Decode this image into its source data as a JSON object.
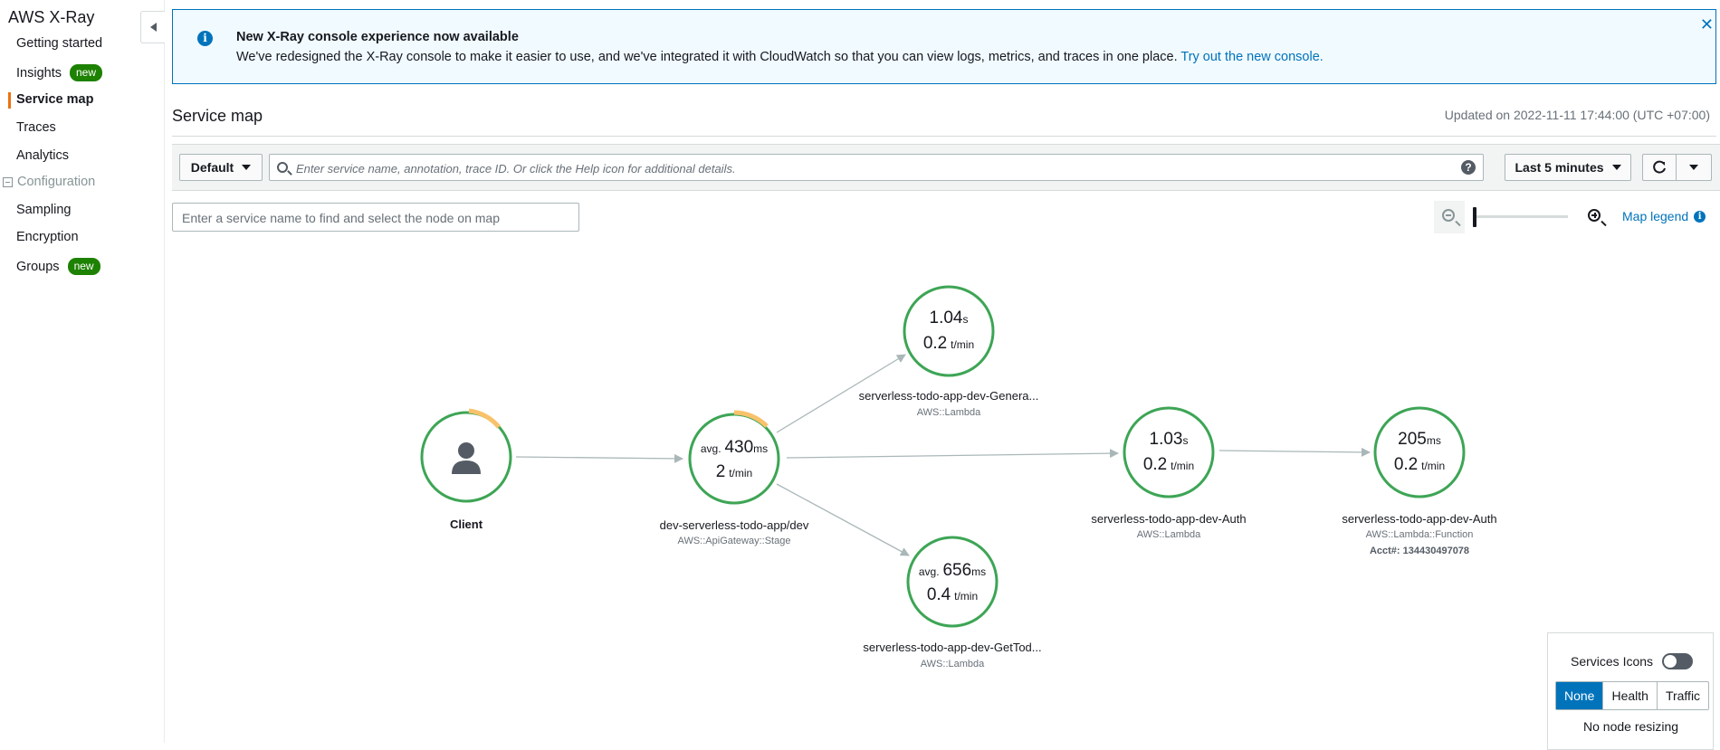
{
  "sidebar": {
    "title": "AWS X-Ray",
    "items": [
      {
        "label": "Getting started"
      },
      {
        "label": "Insights",
        "badge": "new"
      },
      {
        "label": "Service map",
        "active": true
      },
      {
        "label": "Traces"
      },
      {
        "label": "Analytics"
      }
    ],
    "section": "Configuration",
    "config_items": [
      {
        "label": "Sampling"
      },
      {
        "label": "Encryption"
      },
      {
        "label": "Groups",
        "badge": "new"
      }
    ]
  },
  "banner": {
    "title": "New X-Ray console experience now available",
    "text": "We've redesigned the X-Ray console to make it easier to use, and we've integrated it with CloudWatch so that you can view logs, metrics, and traces in one place. ",
    "link": "Try out the new console.",
    "close": "✕"
  },
  "header": {
    "title": "Service map",
    "updated": "Updated on 2022-11-11 17:44:00 (UTC +07:00)"
  },
  "toolbar": {
    "group_select": "Default",
    "search_placeholder": "Enter service name, annotation, trace ID. Or click the Help icon for additional details.",
    "help": "?",
    "time_range": "Last 5 minutes"
  },
  "find_node_placeholder": "Enter a service name to find and select the node on map",
  "zoom": {
    "level": 0.0
  },
  "map_legend": "Map legend",
  "nodes": {
    "client": {
      "name": "Client"
    },
    "apigw": {
      "name": "dev-serverless-todo-app/dev",
      "type": "AWS::ApiGateway::Stage",
      "avg": "avg.",
      "latency": "430",
      "latency_unit": "ms",
      "rate": "2",
      "rate_unit": "t/min"
    },
    "generate": {
      "name": "serverless-todo-app-dev-Genera...",
      "type": "AWS::Lambda",
      "latency": "1.04",
      "latency_unit": "s",
      "rate": "0.2",
      "rate_unit": "t/min"
    },
    "gettodo": {
      "name": "serverless-todo-app-dev-GetTod...",
      "type": "AWS::Lambda",
      "avg": "avg.",
      "latency": "656",
      "latency_unit": "ms",
      "rate": "0.4",
      "rate_unit": "t/min"
    },
    "auth": {
      "name": "serverless-todo-app-dev-Auth",
      "type": "AWS::Lambda",
      "latency": "1.03",
      "latency_unit": "s",
      "rate": "0.2",
      "rate_unit": "t/min"
    },
    "auth_fn": {
      "name": "serverless-todo-app-dev-Auth",
      "type": "AWS::Lambda::Function",
      "acct": "Acct#: 134430497078",
      "latency": "205",
      "latency_unit": "ms",
      "rate": "0.2",
      "rate_unit": "t/min"
    }
  },
  "legend_panel": {
    "services_icons": "Services Icons",
    "modes": [
      "None",
      "Health",
      "Traffic"
    ],
    "selected_mode": "None",
    "resizing": "No node resizing"
  },
  "colors": {
    "ok": "#3da555",
    "warning": "#f8c26b",
    "accent": "#ec7211",
    "link": "#0073bb"
  }
}
